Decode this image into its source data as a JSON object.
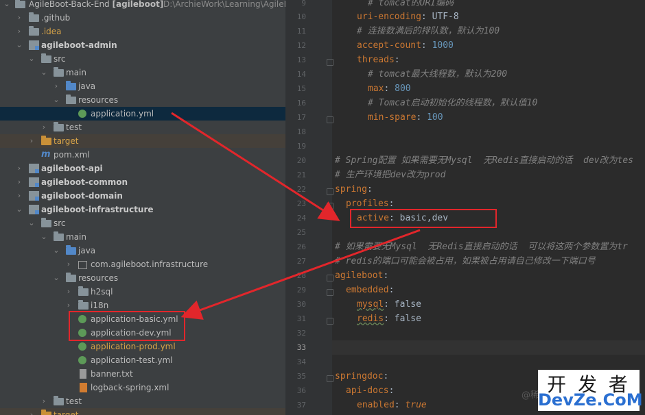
{
  "project_tree": {
    "root_label": "AgileBoot-Back-End",
    "root_module": "[agileboot]",
    "root_path": "D:\\ArchieWork\\Learning\\AgileBo",
    "items": [
      {
        "label": "AgileBoot-Back-End [agileboot]"
      },
      {
        "label": ".github"
      },
      {
        "label": ".idea"
      },
      {
        "label": "agileboot-admin"
      },
      {
        "label": "src"
      },
      {
        "label": "main"
      },
      {
        "label": "java"
      },
      {
        "label": "resources"
      },
      {
        "label": "application.yml"
      },
      {
        "label": "test"
      },
      {
        "label": "target"
      },
      {
        "label": "pom.xml"
      },
      {
        "label": "agileboot-api"
      },
      {
        "label": "agileboot-common"
      },
      {
        "label": "agileboot-domain"
      },
      {
        "label": "agileboot-infrastructure"
      },
      {
        "label": "src"
      },
      {
        "label": "main"
      },
      {
        "label": "java"
      },
      {
        "label": "com.agileboot.infrastructure"
      },
      {
        "label": "resources"
      },
      {
        "label": "h2sql"
      },
      {
        "label": "i18n"
      },
      {
        "label": "application-basic.yml"
      },
      {
        "label": "application-dev.yml"
      },
      {
        "label": "application-prod.yml"
      },
      {
        "label": "application-test.yml"
      },
      {
        "label": "banner.txt"
      },
      {
        "label": "logback-spring.xml"
      },
      {
        "label": "test"
      },
      {
        "label": "target"
      }
    ]
  },
  "editor": {
    "line_numbers": [
      "9",
      "10",
      "11",
      "12",
      "13",
      "14",
      "15",
      "16",
      "17",
      "18",
      "19",
      "20",
      "21",
      "22",
      "23",
      "24",
      "25",
      "26",
      "27",
      "28",
      "29",
      "30",
      "31",
      "32",
      "33",
      "34",
      "35",
      "36",
      "37"
    ],
    "lines": {
      "l9_comment": "# tomcat的URI编码",
      "l10_key": "uri-encoding",
      "l10_val": "UTF-8",
      "l11_comment": "# 连接数满后的排队数，默认为100",
      "l12_key": "accept-count",
      "l12_val": "1000",
      "l13_key": "threads",
      "l14_comment": "# tomcat最大线程数，默认为200",
      "l15_key": "max",
      "l15_val": "800",
      "l16_comment": "# Tomcat启动初始化的线程数，默认值10",
      "l17_key": "min-spare",
      "l17_val": "100",
      "l20_comment": "# Spring配置 如果需要无Mysql  无Redis直接启动的话  dev改为tes",
      "l21_comment": "# 生产环境把dev改为prod",
      "l22_key": "spring",
      "l23_key": "profiles",
      "l24_key": "active",
      "l24_val": "basic,dev",
      "l26_comment": "# 如果需要无Mysql  无Redis直接启动的话  可以将这两个参数置为tr",
      "l27_comment": "# redis的端口可能会被占用，如果被占用请自己修改一下端口号",
      "l28_key": "agileboot",
      "l29_key": "embedded",
      "l30_key": "mysql",
      "l30_val": "false",
      "l31_key": "redis",
      "l31_val": "false",
      "l35_key": "springdoc",
      "l36_key": "api-docs",
      "l37_key": "enabled",
      "l37_val": "true"
    }
  },
  "watermark": {
    "line1": "开 发 者",
    "line2": "DevZe.CoM",
    "at_prefix": "@稀"
  },
  "colors": {
    "annotation_red": "#e2262b",
    "sidebar_bg": "#3c3f41",
    "editor_bg": "#2b2b2b",
    "selection_bg": "#0d293e"
  }
}
